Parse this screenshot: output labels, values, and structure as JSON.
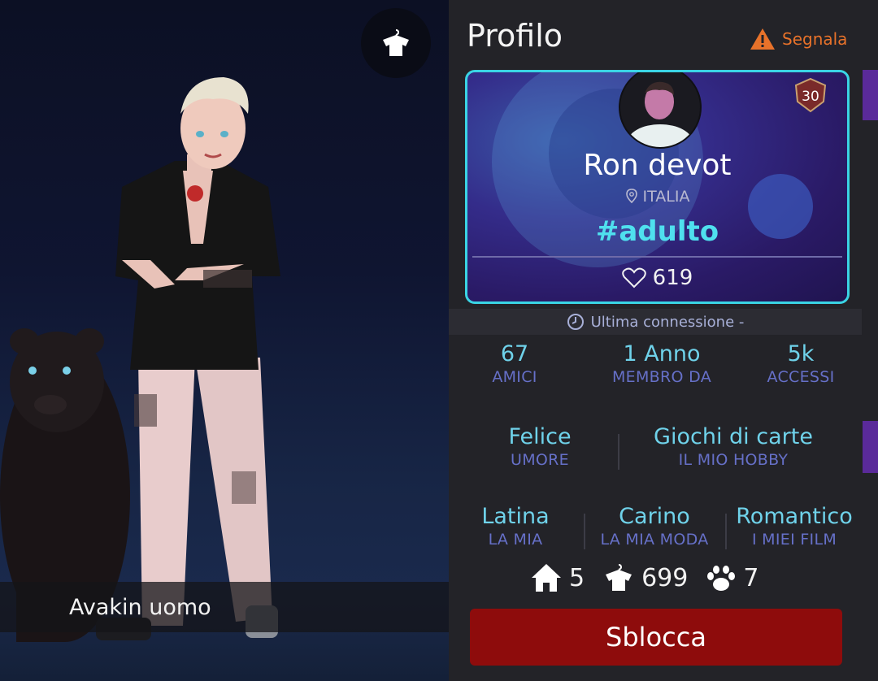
{
  "scene": {
    "caption": "Avakin uomo",
    "wardrobe_icon": "shirt-hanger-icon"
  },
  "profile": {
    "title": "Profilo",
    "report_label": "Segnala",
    "report_icon": "warning-icon",
    "level": "30",
    "name": "Ron devot",
    "country": "ITALIA",
    "hashtag": "#adulto",
    "likes": "619",
    "last_connection": "Ultima connessione -",
    "stats": [
      {
        "value": "67",
        "label": "AMICI"
      },
      {
        "value": "1 Anno",
        "label": "MEMBRO DA"
      },
      {
        "value": "5k",
        "label": "ACCESSI"
      }
    ],
    "traits_row1": [
      {
        "value": "Felice",
        "label": "UMORE"
      },
      {
        "value": "Giochi di carte",
        "label": "IL MIO HOBBY"
      }
    ],
    "traits_row2": [
      {
        "value": "Latina",
        "label": "LA MIA"
      },
      {
        "value": "Carino",
        "label": "LA MIA MODA"
      },
      {
        "value": "Romantico",
        "label": "I MIEI FILM"
      }
    ],
    "counters": {
      "homes": "5",
      "outfits": "699",
      "pets": "7"
    },
    "unlock_button": "Sblocca"
  },
  "colors": {
    "accent_cyan": "#4fe0ee",
    "label_blue": "#6670c8",
    "unlock_red": "#8e0c0c",
    "report_orange": "#e8722a"
  }
}
